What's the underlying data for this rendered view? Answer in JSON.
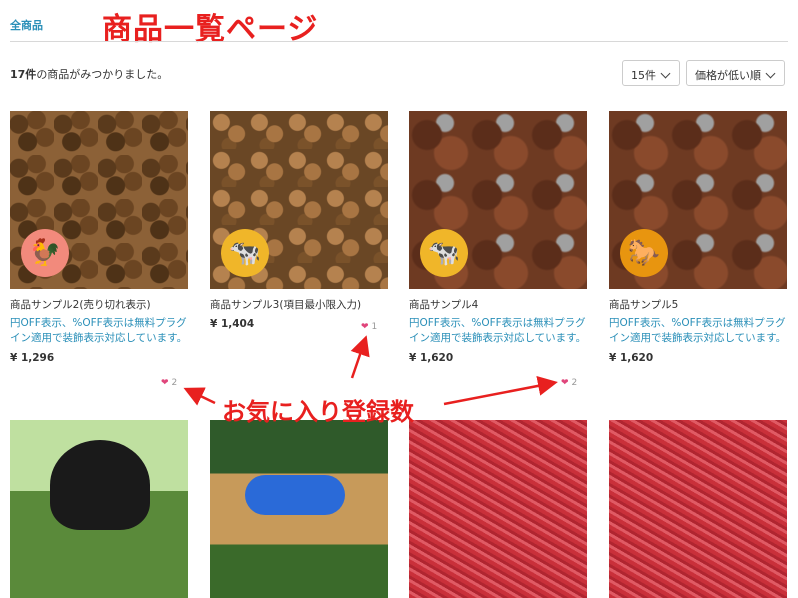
{
  "breadcrumb": "全商品",
  "annotations": {
    "page_title": "商品一覧ページ",
    "favorite_count": "お気に入り登録数"
  },
  "result_count": {
    "num": "17件",
    "suffix": "の商品がみつかりました。"
  },
  "controls": {
    "per_page": "15件",
    "sort": "価格が低い順"
  },
  "products": [
    {
      "name": "商品サンプル2(売り切れ表示)",
      "description": "円OFF表示、%OFF表示は無料プラグイン適用で装飾表示対応しています。",
      "price": "¥ 1,296",
      "favorites": "2",
      "badge": "chicken-icon",
      "badge_color": "#f28a7c"
    },
    {
      "name": "商品サンプル3(項目最小限入力)",
      "description": "",
      "price": "¥ 1,404",
      "favorites": "1",
      "badge": "cow-icon",
      "badge_color": "#f0b629"
    },
    {
      "name": "商品サンプル4",
      "description": "円OFF表示、%OFF表示は無料プラグイン適用で装飾表示対応しています。",
      "price": "¥ 1,620",
      "favorites": "2",
      "badge": "cow-icon",
      "badge_color": "#f0b629"
    },
    {
      "name": "商品サンプル5",
      "description": "円OFF表示、%OFF表示は無料プラグイン適用で装飾表示対応しています。",
      "price": "¥ 1,620",
      "favorites": "",
      "badge": "horse-icon",
      "badge_color": "#e8950f"
    }
  ]
}
